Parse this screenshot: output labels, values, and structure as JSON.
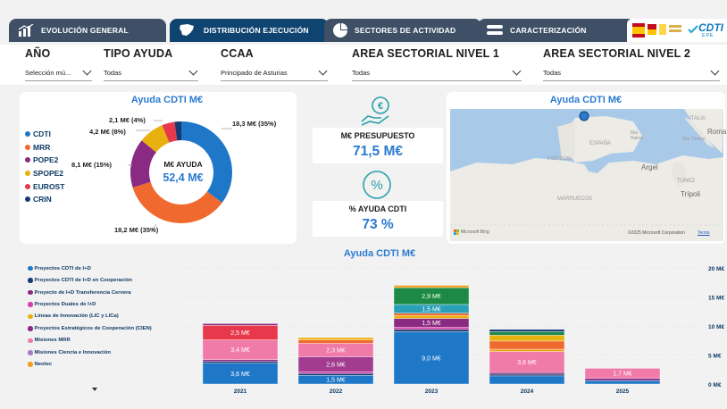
{
  "tabs": [
    {
      "label": "EVOLUCIÓN GENERAL",
      "icon": "bar-chart-icon"
    },
    {
      "label": "DISTRIBUCIÓN EJECUCIÓN",
      "icon": "spain-map-icon"
    },
    {
      "label": "SECTORES DE ACTIVIDAD",
      "icon": "pie-chart-icon"
    },
    {
      "label": "CARACTERIZACIÓN",
      "icon": "menu-icon"
    }
  ],
  "logo": {
    "text": "CDTI",
    "sub": "E.P.E."
  },
  "filters": [
    {
      "label": "AÑO",
      "value": "Selección mú..."
    },
    {
      "label": "TIPO AYUDA",
      "value": "Todas"
    },
    {
      "label": "CCAA",
      "value": "Principado de Asturias"
    },
    {
      "label": "AREA SECTORIAL NIVEL 1",
      "value": "Todas"
    },
    {
      "label": "AREA SECTORIAL NIVEL 2",
      "value": "Todas"
    }
  ],
  "donut": {
    "title": "Ayuda CDTI M€",
    "center_label": "M€ AYUDA",
    "center_value": "52,4 M€",
    "legend": [
      {
        "label": "CDTI",
        "color": "#1f77c8"
      },
      {
        "label": "MRR",
        "color": "#f0692e"
      },
      {
        "label": "POPE2",
        "color": "#8a2a82"
      },
      {
        "label": "SPOPE2",
        "color": "#e9b10f"
      },
      {
        "label": "EUROST",
        "color": "#e8394c"
      },
      {
        "label": "CRIN",
        "color": "#163a74"
      }
    ],
    "slices": [
      {
        "name": "CDTI",
        "value": 18.3,
        "label": "18,3 M€ (35%)",
        "color": "#1f77c8"
      },
      {
        "name": "MRR",
        "value": 18.2,
        "label": "18,2 M€ (35%)",
        "color": "#f0692e"
      },
      {
        "name": "POPE2",
        "value": 8.1,
        "label": "8,1 M€ (15%)",
        "color": "#8a2a82"
      },
      {
        "name": "SPOPE2",
        "value": 4.2,
        "label": "4,2 M€ (8%)",
        "color": "#e9b10f"
      },
      {
        "name": "EUROST",
        "value": 2.1,
        "label": "2,1 M€ (4%)",
        "color": "#e8394c"
      },
      {
        "name": "CRIN",
        "value": 1.1,
        "label": "",
        "color": "#163a74"
      }
    ]
  },
  "kpis": [
    {
      "label": "M€ PRESUPUESTO",
      "value": "71,5 M€",
      "icon": "euro-hand-icon"
    },
    {
      "label": "% AYUDA CDTI",
      "value": "73 %",
      "icon": "percent-icon"
    }
  ],
  "map": {
    "title": "Ayuda CDTI M€",
    "labels": [
      "ITALIA",
      "Roma",
      "Mar Balear",
      "Mar Tirreno",
      "ESPAÑA",
      "PORTUGAL",
      "Argel",
      "TÚNEZ",
      "Trípoli",
      "MARRUECOS"
    ],
    "attribution": "©2025 Microsoft Corporation",
    "terms": "Terms",
    "brand": "Microsoft Bing"
  },
  "bar_legend": [
    {
      "label": "Proyectos CDTI de I+D",
      "color": "#1f77c8"
    },
    {
      "label": "Proyectos CDTI de I+D en Cooperación",
      "color": "#163a74"
    },
    {
      "label": "Proyecto de I+D Transferencia Cervera",
      "color": "#8a2a82"
    },
    {
      "label": "Proyectos Duales de I+D",
      "color": "#d63fa6"
    },
    {
      "label": "Líneas de Innovación (LIC y LICa)",
      "color": "#e9b10f"
    },
    {
      "label": "Proyectos Estratégicos de Cooperación (CIEN)",
      "color": "#8a2a82"
    },
    {
      "label": "Misiones MRR",
      "color": "#f07aa8"
    },
    {
      "label": "Misiones Ciencia e Innovación",
      "color": "#a57cc2"
    },
    {
      "label": "Neotec",
      "color": "#f0a020"
    }
  ],
  "chart_data": {
    "type": "bar",
    "stacked": true,
    "title": "Ayuda CDTI M€",
    "categories": [
      "2021",
      "2022",
      "2023",
      "2024",
      "2025"
    ],
    "ylim": [
      0,
      20
    ],
    "yticks": [
      "0 M€",
      "5 M€",
      "10 M€",
      "15 M€",
      "20 M€"
    ],
    "bars": [
      {
        "year": "2021",
        "segments": [
          {
            "value": 3.6,
            "color": "#1f77c8",
            "label": "3,6 M€"
          },
          {
            "value": 0.3,
            "color": "#163a74",
            "label": ""
          },
          {
            "value": 0.3,
            "color": "#8a2a82",
            "label": ""
          },
          {
            "value": 3.4,
            "color": "#f07aa8",
            "label": "3,4 M€"
          },
          {
            "value": 2.5,
            "color": "#e8394c",
            "label": "2,5 M€"
          },
          {
            "value": 0.3,
            "color": "#8a2a82",
            "label": ""
          }
        ]
      },
      {
        "year": "2022",
        "segments": [
          {
            "value": 1.5,
            "color": "#1f77c8",
            "label": "1,5 M€"
          },
          {
            "value": 0.3,
            "color": "#163a74",
            "label": ""
          },
          {
            "value": 0.3,
            "color": "#d63fa6",
            "label": ""
          },
          {
            "value": 2.6,
            "color": "#a13c8f",
            "label": "2,6 M€"
          },
          {
            "value": 2.3,
            "color": "#f07aa8",
            "label": "2,3 M€"
          },
          {
            "value": 0.6,
            "color": "#f0692e",
            "label": ""
          },
          {
            "value": 0.4,
            "color": "#e9b10f",
            "label": ""
          }
        ]
      },
      {
        "year": "2023",
        "segments": [
          {
            "value": 9.0,
            "color": "#1f77c8",
            "label": "9,0 M€"
          },
          {
            "value": 0.4,
            "color": "#163a74",
            "label": ""
          },
          {
            "value": 0.4,
            "color": "#d63fa6",
            "label": ""
          },
          {
            "value": 1.5,
            "color": "#8a2a82",
            "label": "1,5 M€"
          },
          {
            "value": 0.5,
            "color": "#e9b10f",
            "label": ""
          },
          {
            "value": 0.4,
            "color": "#f0692e",
            "label": ""
          },
          {
            "value": 1.5,
            "color": "#2aa0b8",
            "label": "1,5 M€"
          },
          {
            "value": 2.9,
            "color": "#1c8a46",
            "label": "2,9 M€"
          },
          {
            "value": 0.4,
            "color": "#f0a020",
            "label": ""
          }
        ]
      },
      {
        "year": "2024",
        "segments": [
          {
            "value": 1.4,
            "color": "#1f77c8",
            "label": ""
          },
          {
            "value": 0.3,
            "color": "#163a74",
            "label": ""
          },
          {
            "value": 0.3,
            "color": "#8a2a82",
            "label": ""
          },
          {
            "value": 3.6,
            "color": "#f07aa8",
            "label": "3,6 M€"
          },
          {
            "value": 0.4,
            "color": "#f0a020",
            "label": ""
          },
          {
            "value": 1.4,
            "color": "#f0692e",
            "label": ""
          },
          {
            "value": 1.0,
            "color": "#e9b10f",
            "label": ""
          },
          {
            "value": 0.6,
            "color": "#1c8a46",
            "label": ""
          },
          {
            "value": 0.4,
            "color": "#163a74",
            "label": ""
          }
        ]
      },
      {
        "year": "2025",
        "segments": [
          {
            "value": 0.6,
            "color": "#1f77c8",
            "label": ""
          },
          {
            "value": 0.4,
            "color": "#8a2a82",
            "label": ""
          },
          {
            "value": 1.7,
            "color": "#f07aa8",
            "label": "1,7 M€"
          }
        ]
      }
    ]
  }
}
